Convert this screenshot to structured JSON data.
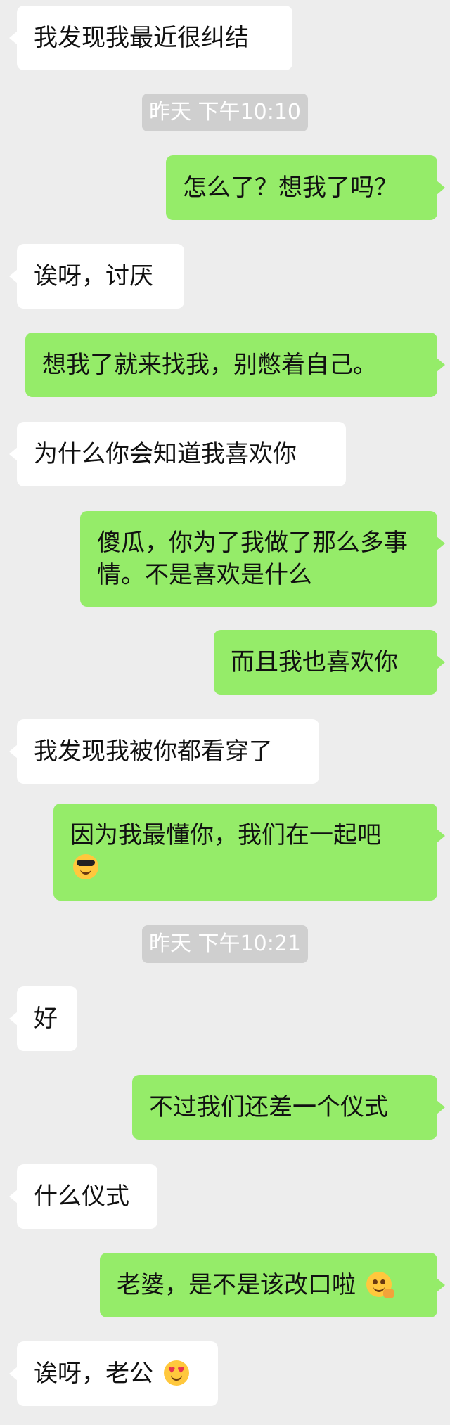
{
  "messages": [
    {
      "from": "them",
      "text": "我发现我最近很纠结"
    },
    {
      "type": "timestamp",
      "text": "昨天 下午10:10"
    },
    {
      "from": "me",
      "text": "怎么了？想我了吗？"
    },
    {
      "from": "them",
      "text": "诶呀，讨厌"
    },
    {
      "from": "me",
      "text": "想我了就来找我，别憋着自己。"
    },
    {
      "from": "them",
      "text": "为什么你会知道我喜欢你"
    },
    {
      "from": "me",
      "text": "傻瓜，你为了我做了那么多事情。不是喜欢是什么"
    },
    {
      "from": "me",
      "text": "而且我也喜欢你"
    },
    {
      "from": "them",
      "text": "我发现我被你都看穿了"
    },
    {
      "from": "me",
      "text": "因为我最懂你，我们在一起吧",
      "emoji": "sunglasses-face-icon"
    },
    {
      "type": "timestamp",
      "text": "昨天 下午10:21"
    },
    {
      "from": "them",
      "text": "好"
    },
    {
      "from": "me",
      "text": "不过我们还差一个仪式"
    },
    {
      "from": "them",
      "text": "什么仪式"
    },
    {
      "from": "me",
      "text": "老婆，是不是该改口啦",
      "emoji": "smirk-face-icon"
    },
    {
      "from": "them",
      "text": "诶呀，老公",
      "emoji": "heart-eyes-face-icon"
    }
  ],
  "colors": {
    "background": "#ededed",
    "incoming_bubble": "#ffffff",
    "outgoing_bubble": "#95ec69",
    "timestamp_bg": "#cfcfcf",
    "timestamp_text": "#ffffff"
  }
}
